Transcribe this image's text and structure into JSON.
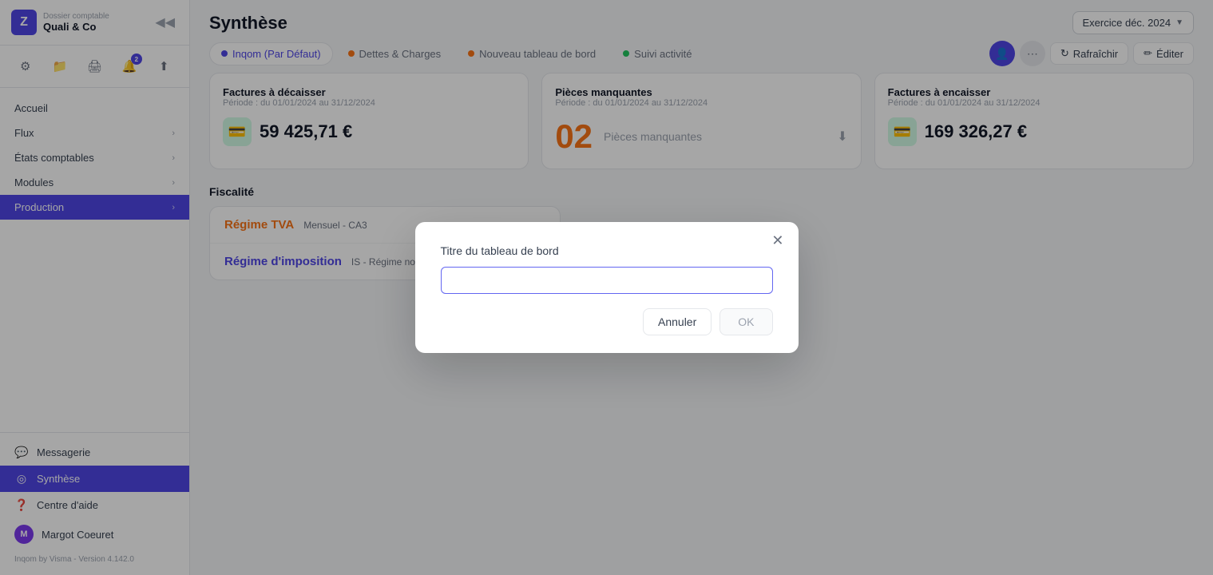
{
  "sidebar": {
    "company_label": "Dossier comptable",
    "company_name": "Quali & Co",
    "toolbar_buttons": [
      {
        "name": "settings-button",
        "icon": "⚙",
        "label": "Paramètres"
      },
      {
        "name": "folder-button",
        "icon": "📁",
        "label": "Dossier"
      },
      {
        "name": "print-button",
        "icon": "🖨",
        "label": "Imprimer"
      },
      {
        "name": "notifications-button",
        "icon": "🔔",
        "label": "Notifications",
        "badge": "2"
      },
      {
        "name": "upload-button",
        "icon": "⬆",
        "label": "Importer"
      }
    ],
    "nav_items": [
      {
        "name": "accueil",
        "label": "Accueil",
        "has_chevron": false
      },
      {
        "name": "flux",
        "label": "Flux",
        "has_chevron": true
      },
      {
        "name": "etats-comptables",
        "label": "États comptables",
        "has_chevron": true
      },
      {
        "name": "modules",
        "label": "Modules",
        "has_chevron": true
      },
      {
        "name": "production",
        "label": "Production",
        "has_chevron": true,
        "active": true
      }
    ],
    "bottom_items": [
      {
        "name": "messagerie",
        "label": "Messagerie",
        "icon": "💬"
      },
      {
        "name": "synthese",
        "label": "Synthèse",
        "active": true,
        "icon": "◎"
      },
      {
        "name": "centre-aide",
        "label": "Centre d'aide",
        "icon": "❓"
      }
    ],
    "user": {
      "name": "Margot Coeuret",
      "initial": "M"
    },
    "version": "Inqom by Visma - Version 4.142.0"
  },
  "header": {
    "page_title": "Synthèse",
    "exercise_label": "Exercice déc. 2024"
  },
  "tabs": [
    {
      "name": "inqom-par-defaut",
      "label": "Inqom (Par Défaut)",
      "dot_color": "#4f46e5",
      "active": true
    },
    {
      "name": "dettes-charges",
      "label": "Dettes & Charges",
      "dot_color": "#f97316"
    },
    {
      "name": "nouveau-tableau",
      "label": "Nouveau tableau de bord",
      "dot_color": "#f97316"
    },
    {
      "name": "suivi-activite",
      "label": "Suivi activité",
      "dot_color": "#22c55e"
    }
  ],
  "tab_actions": {
    "rafraichir_label": "Rafraîchir",
    "editer_label": "Éditer"
  },
  "cards": [
    {
      "name": "factures-decaisser",
      "title": "Factures à décaisser",
      "period": "Période : du 01/01/2024 au 31/12/2024",
      "value": "59 425,71 €",
      "icon": "💳",
      "icon_style": "green"
    },
    {
      "name": "pieces-manquantes",
      "title": "Pièces manquantes",
      "period": "Période : du 01/01/2024 au 31/12/2024",
      "number": "02",
      "label": "Pièces manquantes"
    },
    {
      "name": "factures-encaisser",
      "title": "Factures à encaisser",
      "period": "Période : du 01/01/2024 au 31/12/2024",
      "value": "169 326,27 €",
      "icon": "💳",
      "icon_style": "green"
    }
  ],
  "fiscalite": {
    "section_title": "Fiscalité",
    "rows": [
      {
        "name": "regime-tva",
        "label": "Régime TVA",
        "label_class": "tva",
        "value": "Mensuel - CA3"
      },
      {
        "name": "regime-imposition",
        "label": "Régime d'imposition",
        "label_class": "imposition",
        "value": "IS - Régime normal"
      }
    ]
  },
  "modal": {
    "title": "Titre du tableau de bord",
    "input_placeholder": "",
    "input_value": "",
    "cancel_label": "Annuler",
    "ok_label": "OK"
  }
}
